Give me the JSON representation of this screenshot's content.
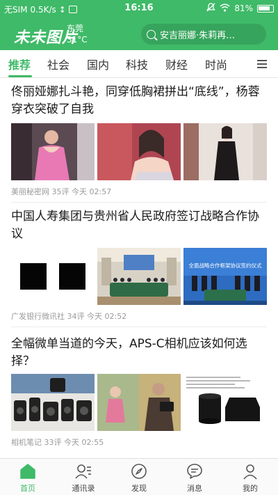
{
  "status_bar": {
    "carrier": "无SIM",
    "speed": "0.5K/s",
    "time": "16:16",
    "battery": "81%"
  },
  "header": {
    "logo": "未未图片",
    "city": "东莞",
    "temperature": "31°C",
    "search_text": "安吉丽娜·朱莉再…"
  },
  "tabs": [
    {
      "label": "推荐",
      "active": true
    },
    {
      "label": "社会"
    },
    {
      "label": "国内"
    },
    {
      "label": "科技"
    },
    {
      "label": "财经"
    },
    {
      "label": "时尚"
    }
  ],
  "articles": [
    {
      "title": "佟丽娅娜扎斗艳，同穿低胸裙拼出“底线”，杨蓉穿衣突破了自我",
      "source": "美丽秘密网",
      "comments": "35评",
      "time": "今天 02:57"
    },
    {
      "title": "中国人寿集团与贵州省人民政府签订战略合作协议",
      "source": "广发银行微讯社",
      "comments": "34评",
      "time": "今天 02:52",
      "thumb_caption": "全面战略合作框架协议签约仪式"
    },
    {
      "title": "全幅微单当道的今天，APS-C相机应该如何选择？",
      "source": "相机笔记",
      "comments": "33评",
      "time": "今天 02:55"
    }
  ],
  "bottom_nav": [
    {
      "label": "首页",
      "icon": "home-icon",
      "active": true
    },
    {
      "label": "通讯录",
      "icon": "contacts-icon"
    },
    {
      "label": "发现",
      "icon": "discover-icon"
    },
    {
      "label": "消息",
      "icon": "message-icon"
    },
    {
      "label": "我的",
      "icon": "profile-icon"
    }
  ],
  "colors": {
    "brand_green": "#3fba68",
    "meta_gray": "#9a9a9a"
  }
}
